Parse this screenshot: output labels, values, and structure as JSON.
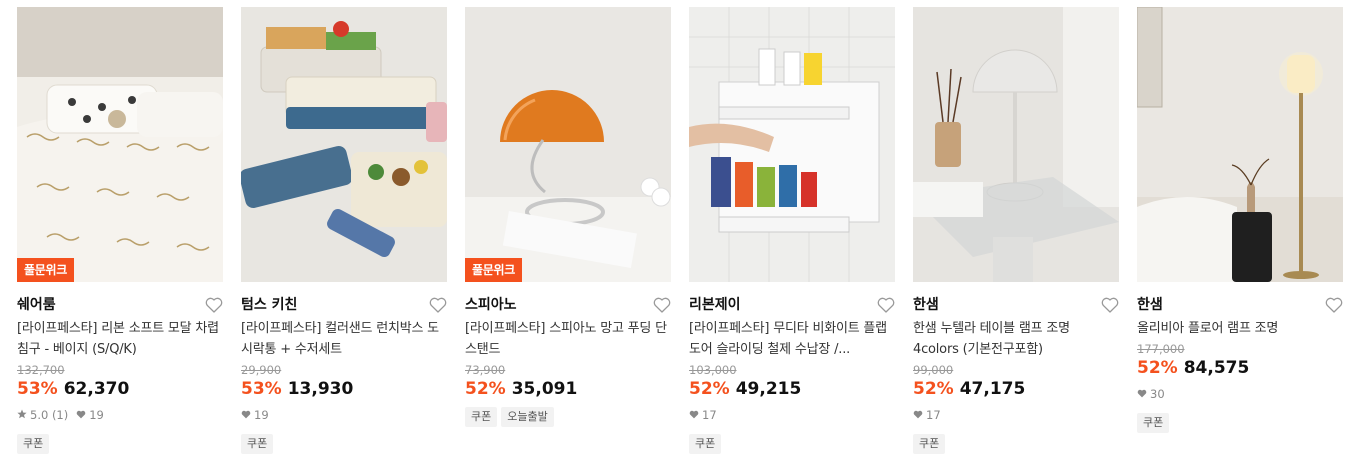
{
  "products": [
    {
      "badge": "풀문위크",
      "brand": "쉐어룸",
      "title": "[라이프페스타] 리본 소프트 모달 차렵침구 - 베이지 (S/Q/K)",
      "original_price": "132,700",
      "discount": "53%",
      "price": "62,370",
      "rating": "5.0 (1)",
      "likes": "19",
      "tags": [
        "쿠폰"
      ]
    },
    {
      "badge": "",
      "brand": "텀스 키친",
      "title": "[라이프페스타] 컬러샌드 런치박스 도시락통 + 수저세트",
      "original_price": "29,900",
      "discount": "53%",
      "price": "13,930",
      "rating": "",
      "likes": "19",
      "tags": [
        "쿠폰"
      ]
    },
    {
      "badge": "풀문위크",
      "brand": "스피아노",
      "title": "[라이프페스타] 스피아노 망고 푸딩 단스탠드",
      "original_price": "73,900",
      "discount": "52%",
      "price": "35,091",
      "rating": "",
      "likes": "",
      "tags": [
        "쿠폰",
        "오늘출발"
      ]
    },
    {
      "badge": "",
      "brand": "리본제이",
      "title": "[라이프페스타] 무디타 비화이트 플랩도어 슬라이딩 철제 수납장 /...",
      "original_price": "103,000",
      "discount": "52%",
      "price": "49,215",
      "rating": "",
      "likes": "17",
      "tags": [
        "쿠폰"
      ]
    },
    {
      "badge": "",
      "brand": "한샘",
      "title": "한샘 누텔라 테이블 램프 조명 4colors (기본전구포함)",
      "original_price": "99,000",
      "discount": "52%",
      "price": "47,175",
      "rating": "",
      "likes": "17",
      "tags": [
        "쿠폰"
      ]
    },
    {
      "badge": "",
      "brand": "한샘",
      "title": "올리비아 플로어 램프 조명",
      "original_price": "177,000",
      "discount": "52%",
      "price": "84,575",
      "rating": "",
      "likes": "30",
      "tags": [
        "쿠폰"
      ]
    }
  ],
  "colors": {
    "accent": "#f4511e",
    "text": "#222222",
    "muted": "#999999"
  },
  "icons": {
    "wishlist": "heart-outline-icon",
    "rating": "star-icon",
    "likes": "heart-icon"
  }
}
